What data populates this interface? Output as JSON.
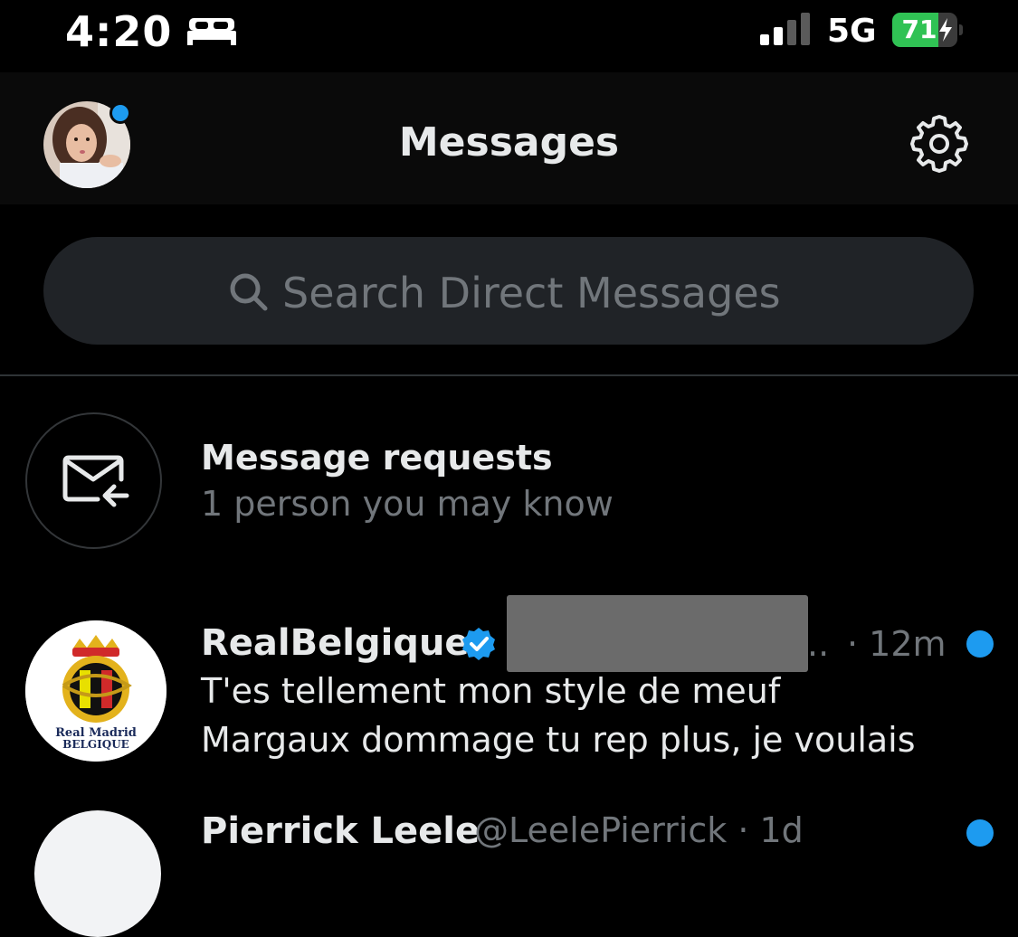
{
  "status_bar": {
    "time": "4:20",
    "focus_icon": "bed-icon",
    "network": "5G",
    "battery_level": "71",
    "battery_fraction": 0.71,
    "battery_color": "#30c254",
    "charging_icon": "bolt-icon"
  },
  "header": {
    "title": "Messages",
    "avatar_icon": "profile-avatar",
    "settings_icon": "gear-icon"
  },
  "search": {
    "placeholder": "Search Direct Messages"
  },
  "message_requests": {
    "title": "Message requests",
    "subtitle": "1 person you may know",
    "icon": "envelope-arrow-icon"
  },
  "conversations": [
    {
      "name": "RealBelgique",
      "verified": true,
      "handle_redacted": true,
      "ellipsis": "..",
      "time": "· 12m",
      "unread": true,
      "message_lines": [
        "T'es tellement mon style de meuf",
        "Margaux dommage tu rep plus, je voulais"
      ],
      "avatar_logo_text": [
        "Real Madrid",
        "BELGIQUE"
      ]
    },
    {
      "name": "Pierrick Leele",
      "handle_time": "@LeelePierrick · 1d",
      "unread": true
    }
  ],
  "colors": {
    "background": "#000000",
    "accent": "#1d9bf0",
    "secondary_text": "#71767b",
    "search_bg": "#202327"
  }
}
